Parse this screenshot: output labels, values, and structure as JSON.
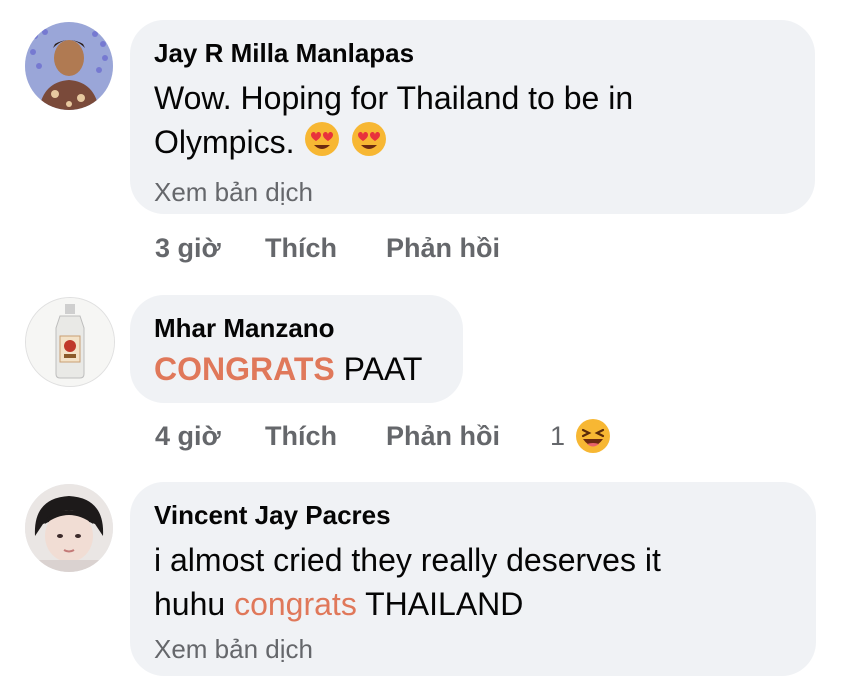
{
  "comments": [
    {
      "author": "Jay R Milla Manlapas",
      "text_line1": "Wow. Hoping for Thailand to be in",
      "text_line2": "Olympics.",
      "emoji": "heart-eyes-emoji",
      "translate": "Xem bản dịch",
      "time": "3 giờ",
      "like": "Thích",
      "reply": "Phản hồi"
    },
    {
      "author": "Mhar Manzano",
      "highlight": "CONGRATS",
      "text_rest": "PAAT",
      "time": "4 giờ",
      "like": "Thích",
      "reply": "Phản hồi",
      "reaction_count": "1",
      "reaction_icon": "laughing-emoji"
    },
    {
      "author": "Vincent Jay Pacres",
      "text_line1": "i almost cried they really deserves it",
      "text_pre": "huhu",
      "highlight": "congrats",
      "text_post": "THAILAND",
      "translate": "Xem bản dịch"
    }
  ],
  "colors": {
    "bubble": "#f0f2f5",
    "text": "#050505",
    "secondary": "#65676b",
    "highlight": "#e0785a"
  }
}
